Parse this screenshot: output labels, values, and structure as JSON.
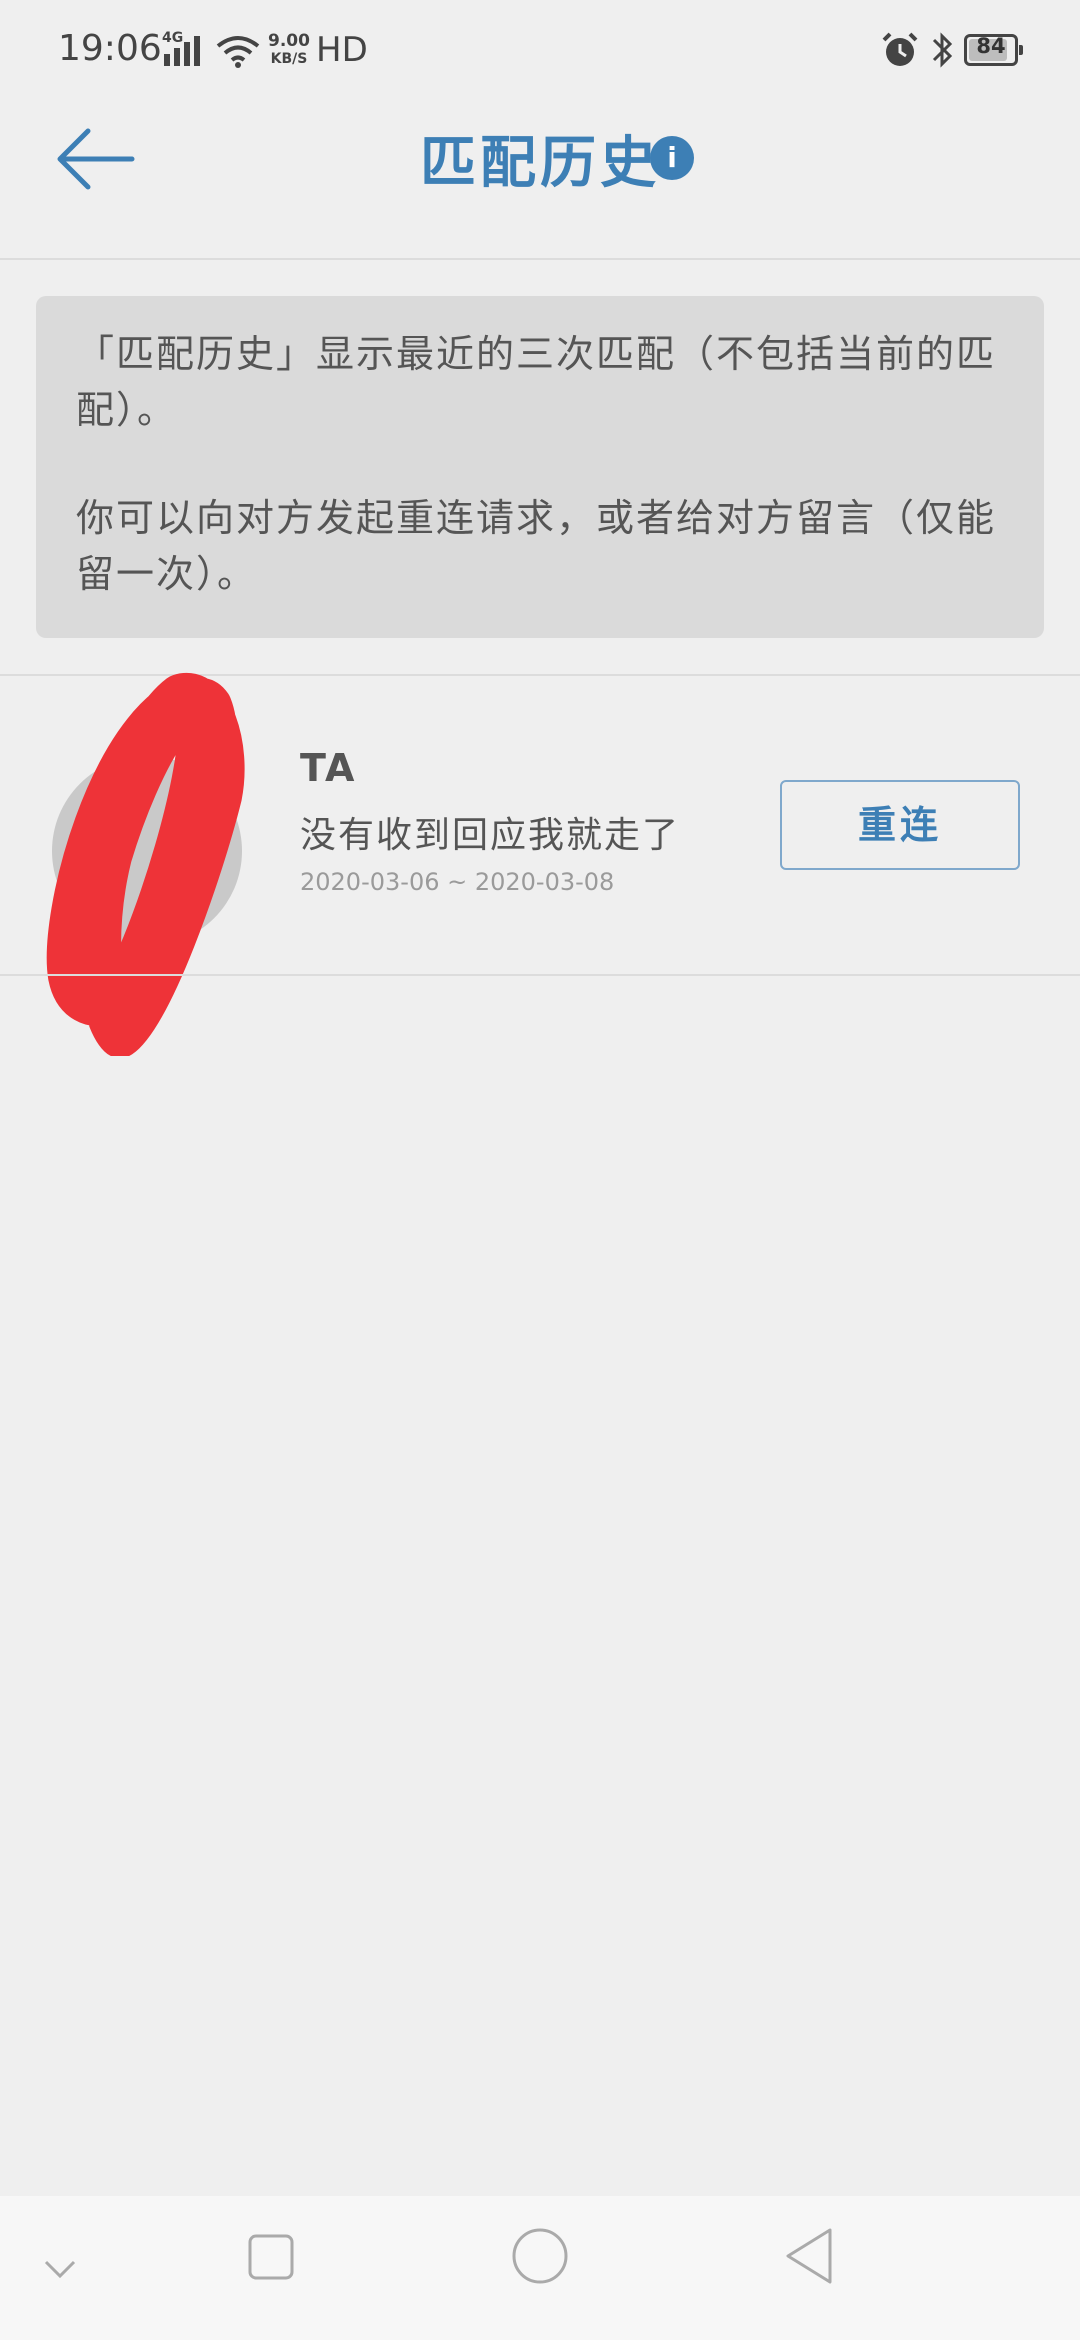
{
  "status_bar": {
    "time": "19:06",
    "network": "4G",
    "speed_value": "9.00",
    "speed_unit": "KB/S",
    "hd": "HD",
    "battery": "84"
  },
  "header": {
    "title": "匹配历史",
    "info_icon": "i"
  },
  "notice": {
    "line1": "「匹配历史」显示最近的三次匹配（不包括当前的匹配）。",
    "line2": "你可以向对方发起重连请求，或者给对方留言（仅能留一次）。"
  },
  "matches": [
    {
      "name": "TA",
      "message": "没有收到回应我就走了",
      "dates": "2020-03-06 ~ 2020-03-08",
      "action_label": "重连"
    }
  ],
  "icons": {
    "back": "arrow-left-icon",
    "info": "info-icon",
    "alarm": "alarm-icon",
    "bluetooth": "bluetooth-icon",
    "nav_collapse": "chevron-down-icon",
    "nav_recent": "square-icon",
    "nav_home": "circle-icon",
    "nav_back": "triangle-back-icon"
  },
  "colors": {
    "accent": "#3d7fb5",
    "background": "#efefef",
    "notice_bg": "#dadada",
    "redaction": "#ee3338"
  }
}
